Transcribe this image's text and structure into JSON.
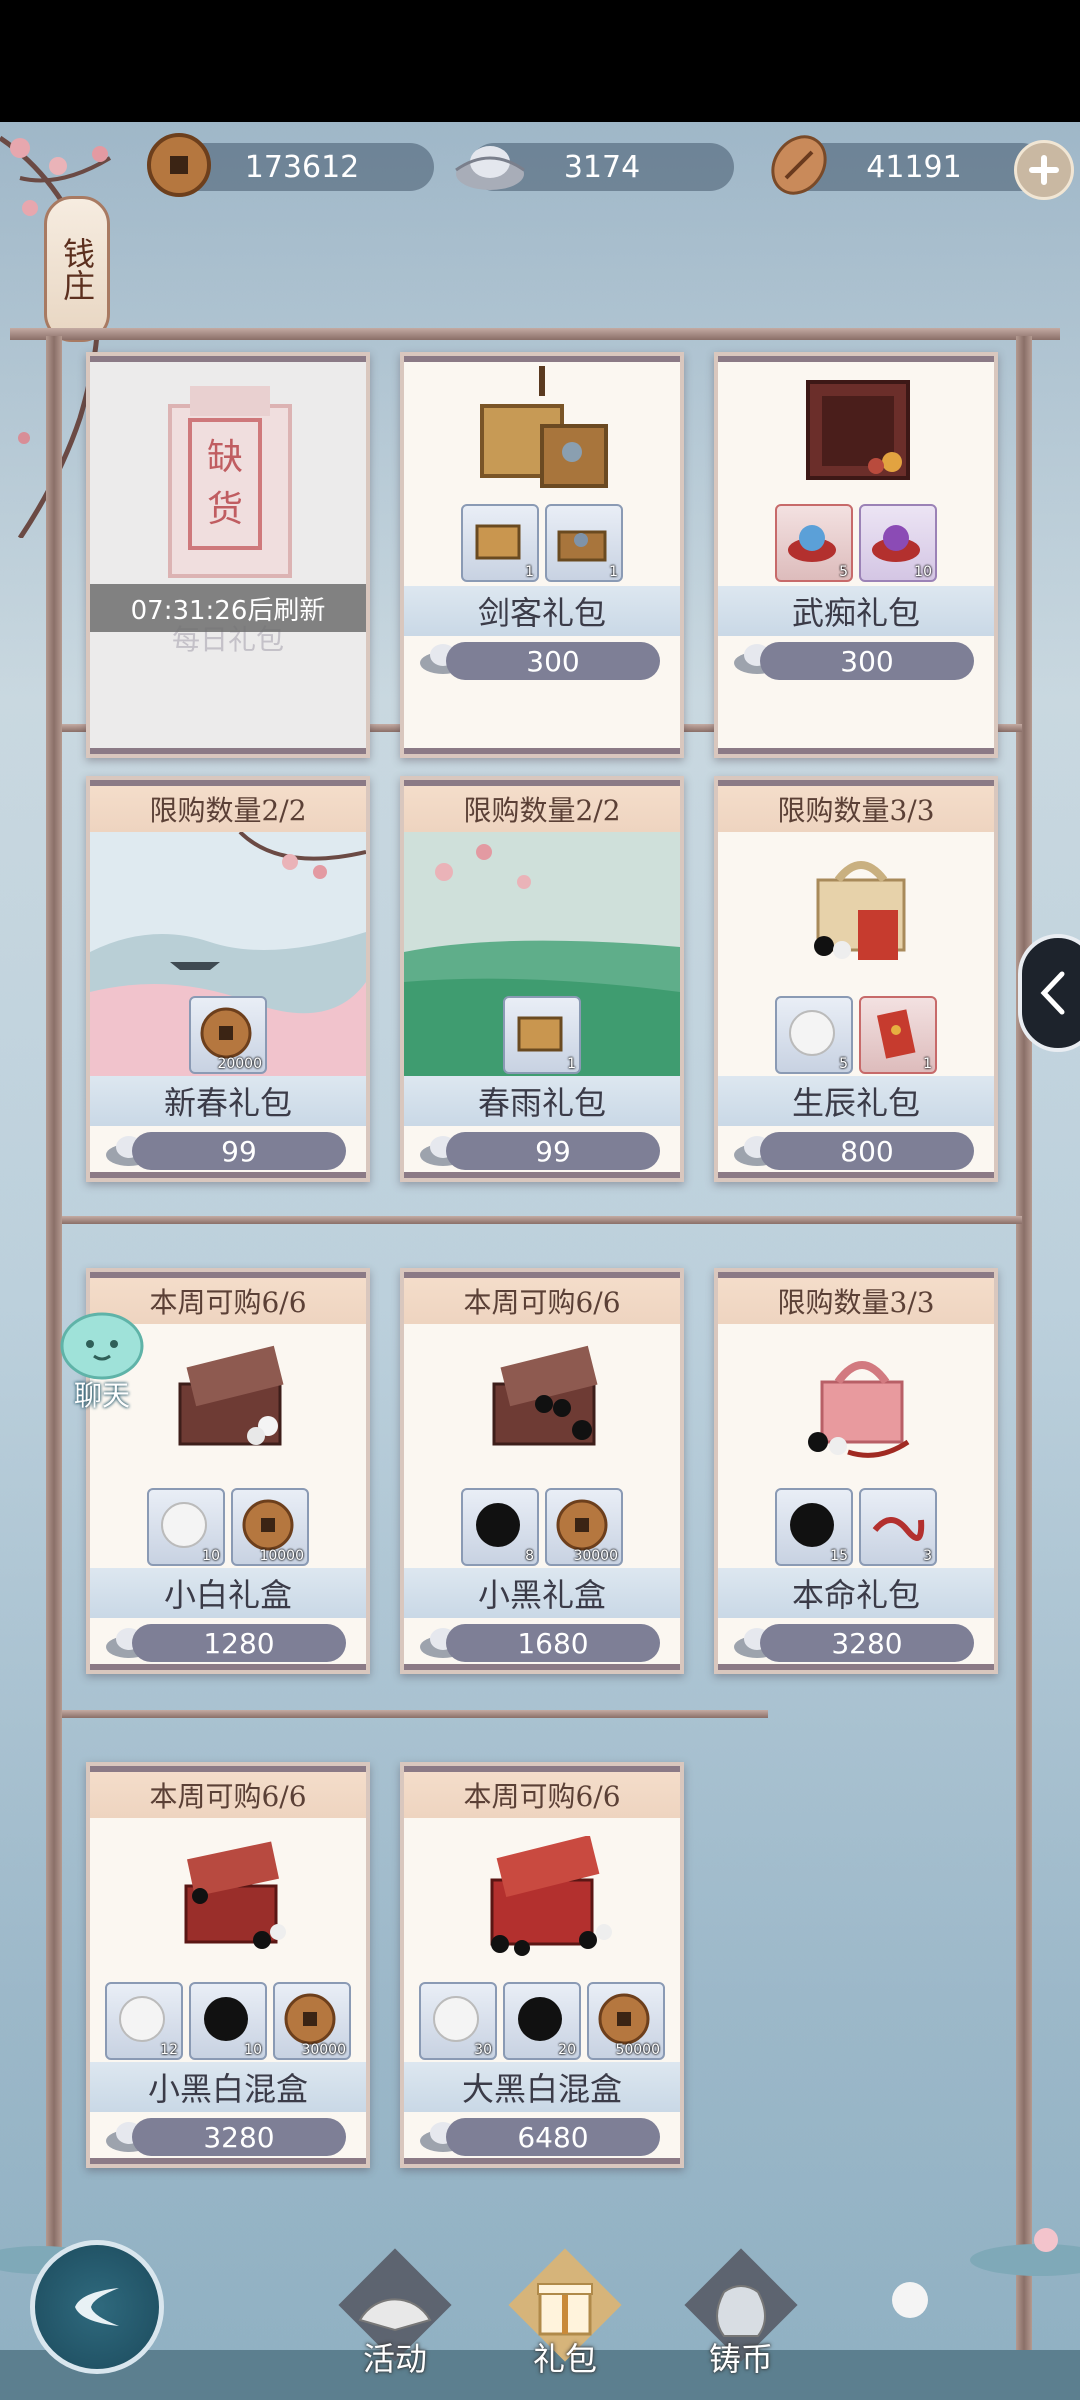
{
  "currency": {
    "copper": "173612",
    "silver": "3174",
    "shell": "41191"
  },
  "shop_tag": "钱庄",
  "sold_out": {
    "stamp": "缺货",
    "timer": "07:31:26后刷新",
    "name": "每日礼包"
  },
  "row1": [
    {
      "name": "剑客礼包",
      "price": "300",
      "items": [
        {
          "icon": "chest-icon",
          "count": "1"
        },
        {
          "icon": "open-chest-icon",
          "count": "1"
        }
      ]
    },
    {
      "name": "武痴礼包",
      "price": "300",
      "items": [
        {
          "icon": "blue-orb-icon",
          "count": "5"
        },
        {
          "icon": "purple-orb-icon",
          "count": "10"
        }
      ]
    }
  ],
  "row2": [
    {
      "limit": "限购数量2/2",
      "name": "新春礼包",
      "price": "99",
      "items": [
        {
          "icon": "copper-coin-icon",
          "count": "20000"
        }
      ]
    },
    {
      "limit": "限购数量2/2",
      "name": "春雨礼包",
      "price": "99",
      "items": [
        {
          "icon": "chest-icon",
          "count": "1"
        }
      ]
    },
    {
      "limit": "限购数量3/3",
      "name": "生辰礼包",
      "price": "800",
      "items": [
        {
          "icon": "white-stone-icon",
          "count": "5"
        },
        {
          "icon": "red-envelope-icon",
          "count": "1"
        }
      ]
    }
  ],
  "row3": [
    {
      "limit": "本周可购6/6",
      "name": "小白礼盒",
      "price": "1280",
      "items": [
        {
          "icon": "white-stone-icon",
          "count": "10"
        },
        {
          "icon": "copper-coin-icon",
          "count": "10000"
        }
      ]
    },
    {
      "limit": "本周可购6/6",
      "name": "小黑礼盒",
      "price": "1680",
      "items": [
        {
          "icon": "black-stone-icon",
          "count": "8"
        },
        {
          "icon": "copper-coin-icon",
          "count": "30000"
        }
      ]
    },
    {
      "limit": "限购数量3/3",
      "name": "本命礼包",
      "price": "3280",
      "items": [
        {
          "icon": "black-stone-icon",
          "count": "15"
        },
        {
          "icon": "red-cord-icon",
          "count": "3"
        }
      ]
    }
  ],
  "row4": [
    {
      "limit": "本周可购6/6",
      "name": "小黑白混盒",
      "price": "3280",
      "items": [
        {
          "icon": "white-stone-icon",
          "count": "12"
        },
        {
          "icon": "black-stone-icon",
          "count": "10"
        },
        {
          "icon": "copper-coin-icon",
          "count": "30000"
        }
      ]
    },
    {
      "limit": "本周可购6/6",
      "name": "大黑白混盒",
      "price": "6480",
      "items": [
        {
          "icon": "white-stone-icon",
          "count": "30"
        },
        {
          "icon": "black-stone-icon",
          "count": "20"
        },
        {
          "icon": "copper-coin-icon",
          "count": "50000"
        }
      ]
    }
  ],
  "chat_label": "聊天",
  "nav": {
    "activity": "活动",
    "gift": "礼包",
    "mint": "铸币"
  }
}
